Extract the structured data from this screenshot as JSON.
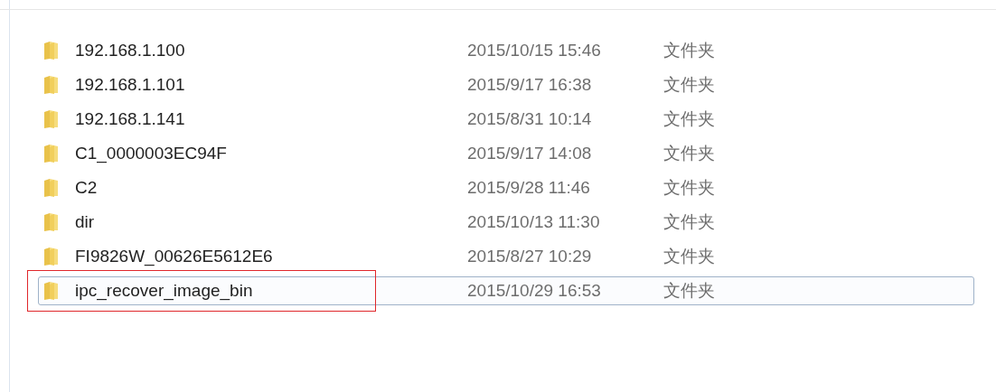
{
  "files": [
    {
      "name": "192.168.1.100",
      "modified": "2015/10/15 15:46",
      "type": "文件夹",
      "focused": false,
      "annotated": false
    },
    {
      "name": "192.168.1.101",
      "modified": "2015/9/17 16:38",
      "type": "文件夹",
      "focused": false,
      "annotated": false
    },
    {
      "name": "192.168.1.141",
      "modified": "2015/8/31 10:14",
      "type": "文件夹",
      "focused": false,
      "annotated": false
    },
    {
      "name": "C1_0000003EC94F",
      "modified": "2015/9/17 14:08",
      "type": "文件夹",
      "focused": false,
      "annotated": false
    },
    {
      "name": "C2",
      "modified": "2015/9/28 11:46",
      "type": "文件夹",
      "focused": false,
      "annotated": false
    },
    {
      "name": "dir",
      "modified": "2015/10/13 11:30",
      "type": "文件夹",
      "focused": false,
      "annotated": false
    },
    {
      "name": "FI9826W_00626E5612E6",
      "modified": "2015/8/27 10:29",
      "type": "文件夹",
      "focused": false,
      "annotated": false
    },
    {
      "name": "ipc_recover_image_bin",
      "modified": "2015/10/29 16:53",
      "type": "文件夹",
      "focused": true,
      "annotated": true
    }
  ]
}
